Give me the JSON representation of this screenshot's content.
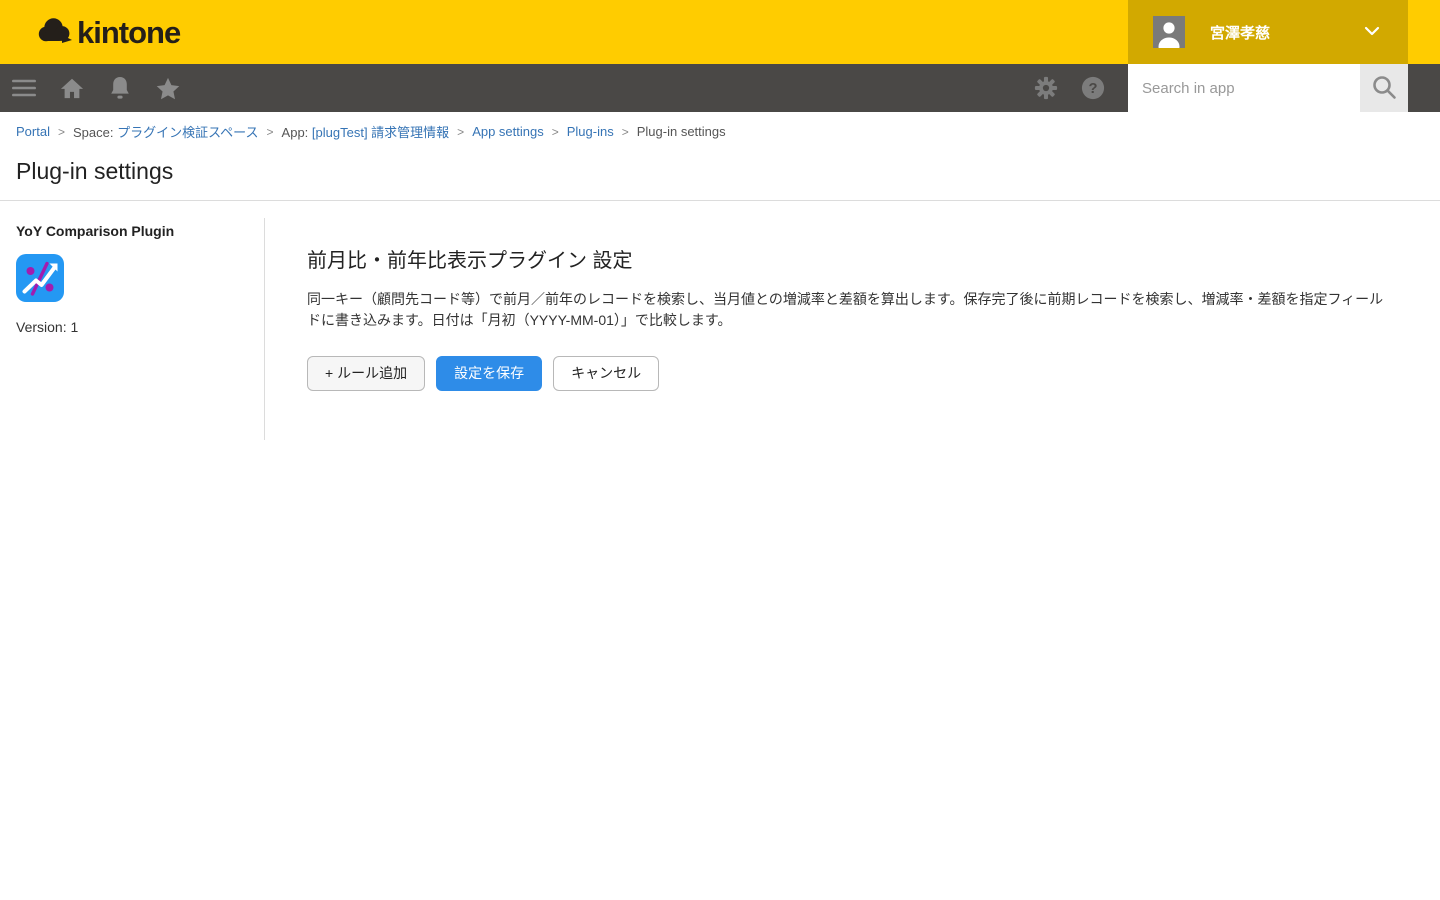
{
  "header": {
    "logo_text": "kintone",
    "user": {
      "name": "宮澤孝慈"
    }
  },
  "toolbar": {
    "search_placeholder": "Search in app"
  },
  "breadcrumb": {
    "separator": ">",
    "items": [
      {
        "label": "Portal"
      },
      {
        "prefix": "Space: ",
        "label": "プラグイン検証スペース"
      },
      {
        "prefix": "App: ",
        "label": "[plugTest] 請求管理情報"
      },
      {
        "label": "App settings"
      },
      {
        "label": "Plug-ins"
      },
      {
        "label": "Plug-in settings"
      }
    ]
  },
  "page": {
    "title": "Plug-in settings"
  },
  "sidebar": {
    "plugin_name": "YoY Comparison Plugin",
    "version": "Version: 1"
  },
  "main": {
    "heading": "前月比・前年比表示プラグイン 設定",
    "description": "同一キー（顧問先コード等）で前月／前年のレコードを検索し、当月値との増減率と差額を算出します。保存完了後に前期レコードを検索し、増減率・差額を指定フィールドに書き込みます。日付は「月初（YYYY-MM-01）」で比較します。",
    "buttons": {
      "add_rule": "+ ルール追加",
      "save": "設定を保存",
      "cancel": "キャンセル"
    }
  },
  "colors": {
    "header_bg": "#FFCC00",
    "user_menu_bg": "#D2A900",
    "toolbar_bg": "#4A4846",
    "primary_button": "#2E8CE8",
    "link": "#3674B5",
    "plugin_icon_blue": "#2498F3",
    "plugin_icon_purple": "#A21CAF"
  }
}
